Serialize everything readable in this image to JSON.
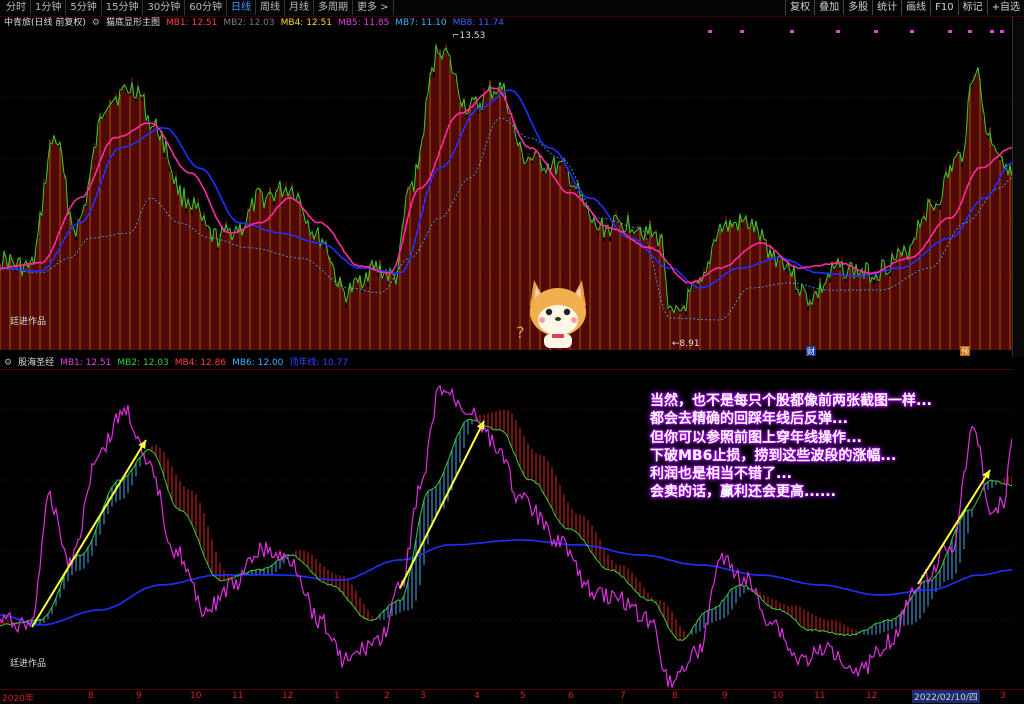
{
  "toolbar": {
    "left": [
      {
        "label": "分时"
      },
      {
        "label": "1分钟"
      },
      {
        "label": "5分钟"
      },
      {
        "label": "15分钟"
      },
      {
        "label": "30分钟"
      },
      {
        "label": "60分钟"
      },
      {
        "label": "日线",
        "active": true
      },
      {
        "label": "周线"
      },
      {
        "label": "月线"
      },
      {
        "label": "多周期"
      },
      {
        "label": "更多 >"
      }
    ],
    "right": [
      {
        "label": "复权"
      },
      {
        "label": "叠加"
      },
      {
        "label": "多股"
      },
      {
        "label": "统计"
      },
      {
        "label": "画线"
      },
      {
        "label": "F10"
      },
      {
        "label": "标记"
      },
      {
        "label": "+自选"
      }
    ]
  },
  "main_panel": {
    "stock": "中青旅(日线 前复权)",
    "indicator": "猫底显形主图",
    "legend": [
      {
        "label": "MB1: 12.51",
        "color": "#ff4040"
      },
      {
        "label": "MB2: 12.03",
        "color": "#7a7a7a"
      },
      {
        "label": "MB4: 12.51",
        "color": "#ffdd22"
      },
      {
        "label": "MB5: 11.85",
        "color": "#e040e0"
      },
      {
        "label": "MB7: 11.10",
        "color": "#38b0ff"
      },
      {
        "label": "MB8: 11.74",
        "color": "#4060ff"
      }
    ],
    "high_label": "13.53",
    "low_label": "8.91",
    "watermark": "廷进作品",
    "marker1": "财",
    "marker2": "预"
  },
  "sub_panel": {
    "indicator": "股海圣经",
    "legend": [
      {
        "label": "MB1: 12.51",
        "color": "#e040e0"
      },
      {
        "label": "MB2: 12.03",
        "color": "#30d030"
      },
      {
        "label": "MB4: 12.86",
        "color": "#ff4040"
      },
      {
        "label": "MB6: 12.00",
        "color": "#38b0ff"
      },
      {
        "label": "顶年线: 10.77",
        "color": "#3040ff"
      }
    ],
    "watermark": "廷进作品"
  },
  "annotation_lines": [
    "当然，也不是每只个股都像前两张截图一样...",
    "都会去精确的回踩年线后反弹...",
    "但你可以参照前图上穿年线操作...",
    "下破MB6止损，捞到这些波段的涨幅...",
    "利润也是相当不错了...",
    "会卖的话，赢利还会更高......"
  ],
  "x_axis": {
    "labels": [
      "2020年",
      "8",
      "9",
      "10",
      "11",
      "12",
      "1",
      "2",
      "3",
      "4",
      "5",
      "6",
      "7",
      "8",
      "9",
      "10",
      "11",
      "12",
      "3"
    ],
    "current_date": "2022/02/10/四"
  },
  "colors": {
    "up_bar": "#c01818",
    "pink_line": "#ff2aa0",
    "blue_line": "#3040ff",
    "green_line": "#30d030",
    "magenta_line": "#e030e0",
    "arrow": "#ffff40"
  },
  "icons": {
    "mascot": "dog-mascot-icon",
    "gear": "gear-icon"
  }
}
